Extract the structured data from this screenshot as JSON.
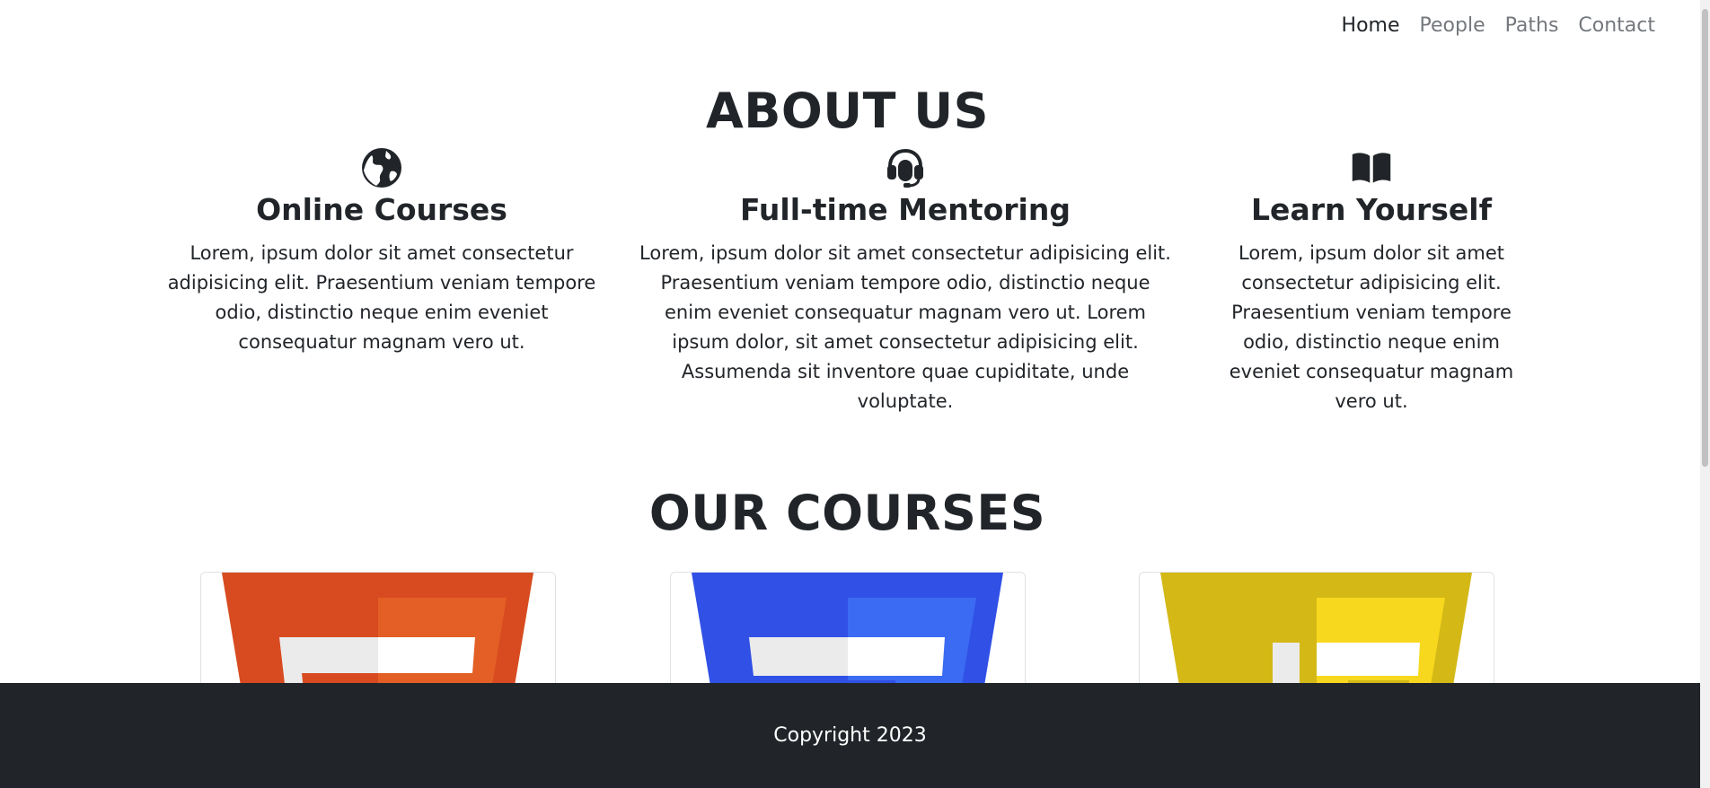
{
  "nav": {
    "items": [
      {
        "label": "Home",
        "active": true
      },
      {
        "label": "People",
        "active": false
      },
      {
        "label": "Paths",
        "active": false
      },
      {
        "label": "Contact",
        "active": false
      }
    ]
  },
  "about": {
    "title": "ABOUT US",
    "features": [
      {
        "icon": "globe-icon",
        "title": "Online Courses",
        "text": "Lorem, ipsum dolor sit amet consectetur adipisicing elit. Praesentium veniam tempore odio, distinctio neque enim eveniet consequatur magnam vero ut."
      },
      {
        "icon": "headset-icon",
        "title": "Full-time Mentoring",
        "text": "Lorem, ipsum dolor sit amet consectetur adipisicing elit. Praesentium veniam tempore odio, distinctio neque enim eveniet consequatur magnam vero ut. Lorem ipsum dolor, sit amet consectetur adipisicing elit. Assumenda sit inventore quae cupiditate, unde voluptate."
      },
      {
        "icon": "book-icon",
        "title": "Learn Yourself",
        "text": "Lorem, ipsum dolor sit amet consectetur adipisicing elit. Praesentium veniam tempore odio, distinctio neque enim eveniet consequatur magnam vero ut."
      }
    ]
  },
  "courses": {
    "title": "OUR COURSES",
    "cards": [
      {
        "icon": "html5-logo-icon",
        "color": "#e44d26",
        "light": "#f16529"
      },
      {
        "icon": "css3-logo-icon",
        "color": "#264de4",
        "light": "#2965f1"
      },
      {
        "icon": "javascript-logo-icon",
        "color": "#d4b830",
        "light": "#f7df1e"
      }
    ]
  },
  "footer": {
    "copyright": "Copyright 2023"
  }
}
